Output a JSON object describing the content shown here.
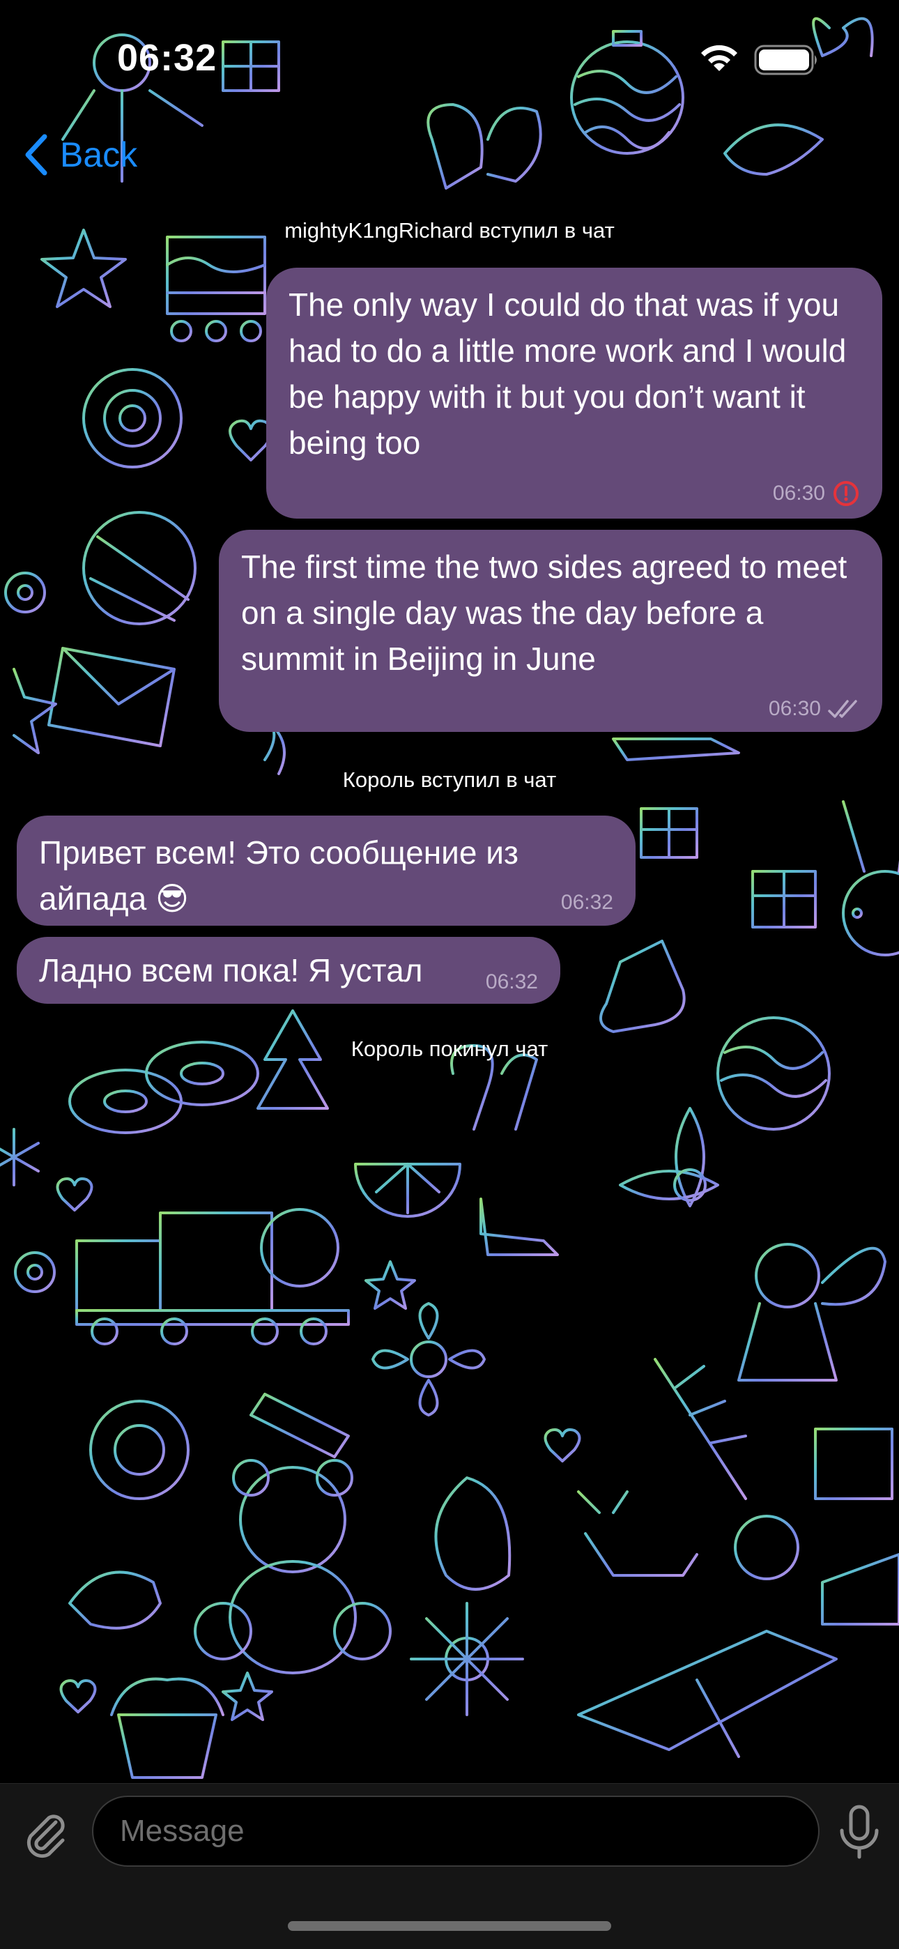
{
  "status_bar": {
    "time": "06:32"
  },
  "nav": {
    "back_label": "Back"
  },
  "service_messages": [
    "mightyK1ngRichard вступил в чат",
    "Король вступил в чат",
    "Король покинул чат"
  ],
  "messages": [
    {
      "text": "The only way I could do that was if you had to do a little more work and I would be happy with it but you don’t want it being too",
      "time": "06:30",
      "status": "error-icon"
    },
    {
      "text": "The first time the two sides agreed to meet on a single day was the day before a summit in Beijing in June",
      "time": "06:30",
      "status": "double-check-icon"
    },
    {
      "text": "Привет всем! Это сообщение из айпада 😎",
      "time": "06:32"
    },
    {
      "text": "Ладно всем пока! Я устал",
      "time": "06:32"
    }
  ],
  "input": {
    "placeholder": "Message"
  },
  "colors": {
    "bubble": "#644a78",
    "accent": "#1a8cff",
    "error": "#e5333b",
    "background": "#000000"
  }
}
